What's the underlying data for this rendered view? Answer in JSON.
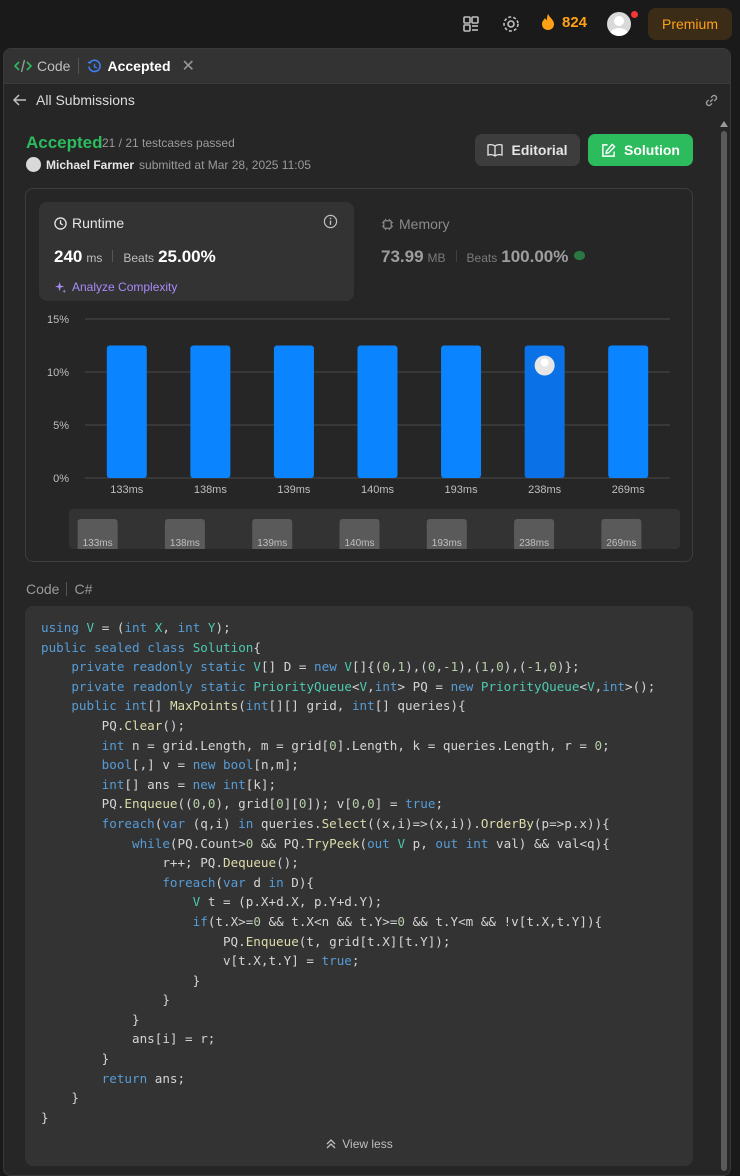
{
  "topbar": {
    "streak_count": "824",
    "premium_label": "Premium",
    "icons": [
      "layout-icon",
      "gear-icon",
      "fire-icon",
      "avatar"
    ]
  },
  "tabs": [
    {
      "label": "Code",
      "icon": "code-icon"
    },
    {
      "label": "Accepted",
      "icon": "history-icon"
    }
  ],
  "subheader": {
    "back_label": "All Submissions"
  },
  "submission": {
    "status": "Accepted",
    "testcases": "21 / 21 testcases passed",
    "user": "Michael Farmer",
    "submitted_text": "submitted at Mar 28, 2025 11:05"
  },
  "actions": {
    "editorial_label": "Editorial",
    "solution_label": "Solution"
  },
  "runtime": {
    "title": "Runtime",
    "value": "240",
    "unit": "ms",
    "beats_label": "Beats",
    "beats": "25.00%",
    "analyze_label": "Analyze Complexity"
  },
  "memory": {
    "title": "Memory",
    "value": "73.99",
    "unit": "MB",
    "beats_label": "Beats",
    "beats": "100.00%"
  },
  "colors": {
    "accent_green": "#2cbb5d",
    "bar_blue": "#0a84ff",
    "bar_highlight": "#0a72e6",
    "premium_orange": "#ffa116"
  },
  "chart_data": {
    "type": "bar",
    "categories": [
      "133ms",
      "138ms",
      "139ms",
      "140ms",
      "193ms",
      "238ms",
      "269ms"
    ],
    "values": [
      12.5,
      12.5,
      12.5,
      12.5,
      12.5,
      12.5,
      12.5
    ],
    "ylim": [
      0,
      15
    ],
    "yticks": [
      "0%",
      "5%",
      "10%",
      "15%"
    ],
    "highlight_category": "238ms",
    "grid": true
  },
  "code_section": {
    "label": "Code",
    "language": "C#",
    "view_less_label": "View less"
  }
}
